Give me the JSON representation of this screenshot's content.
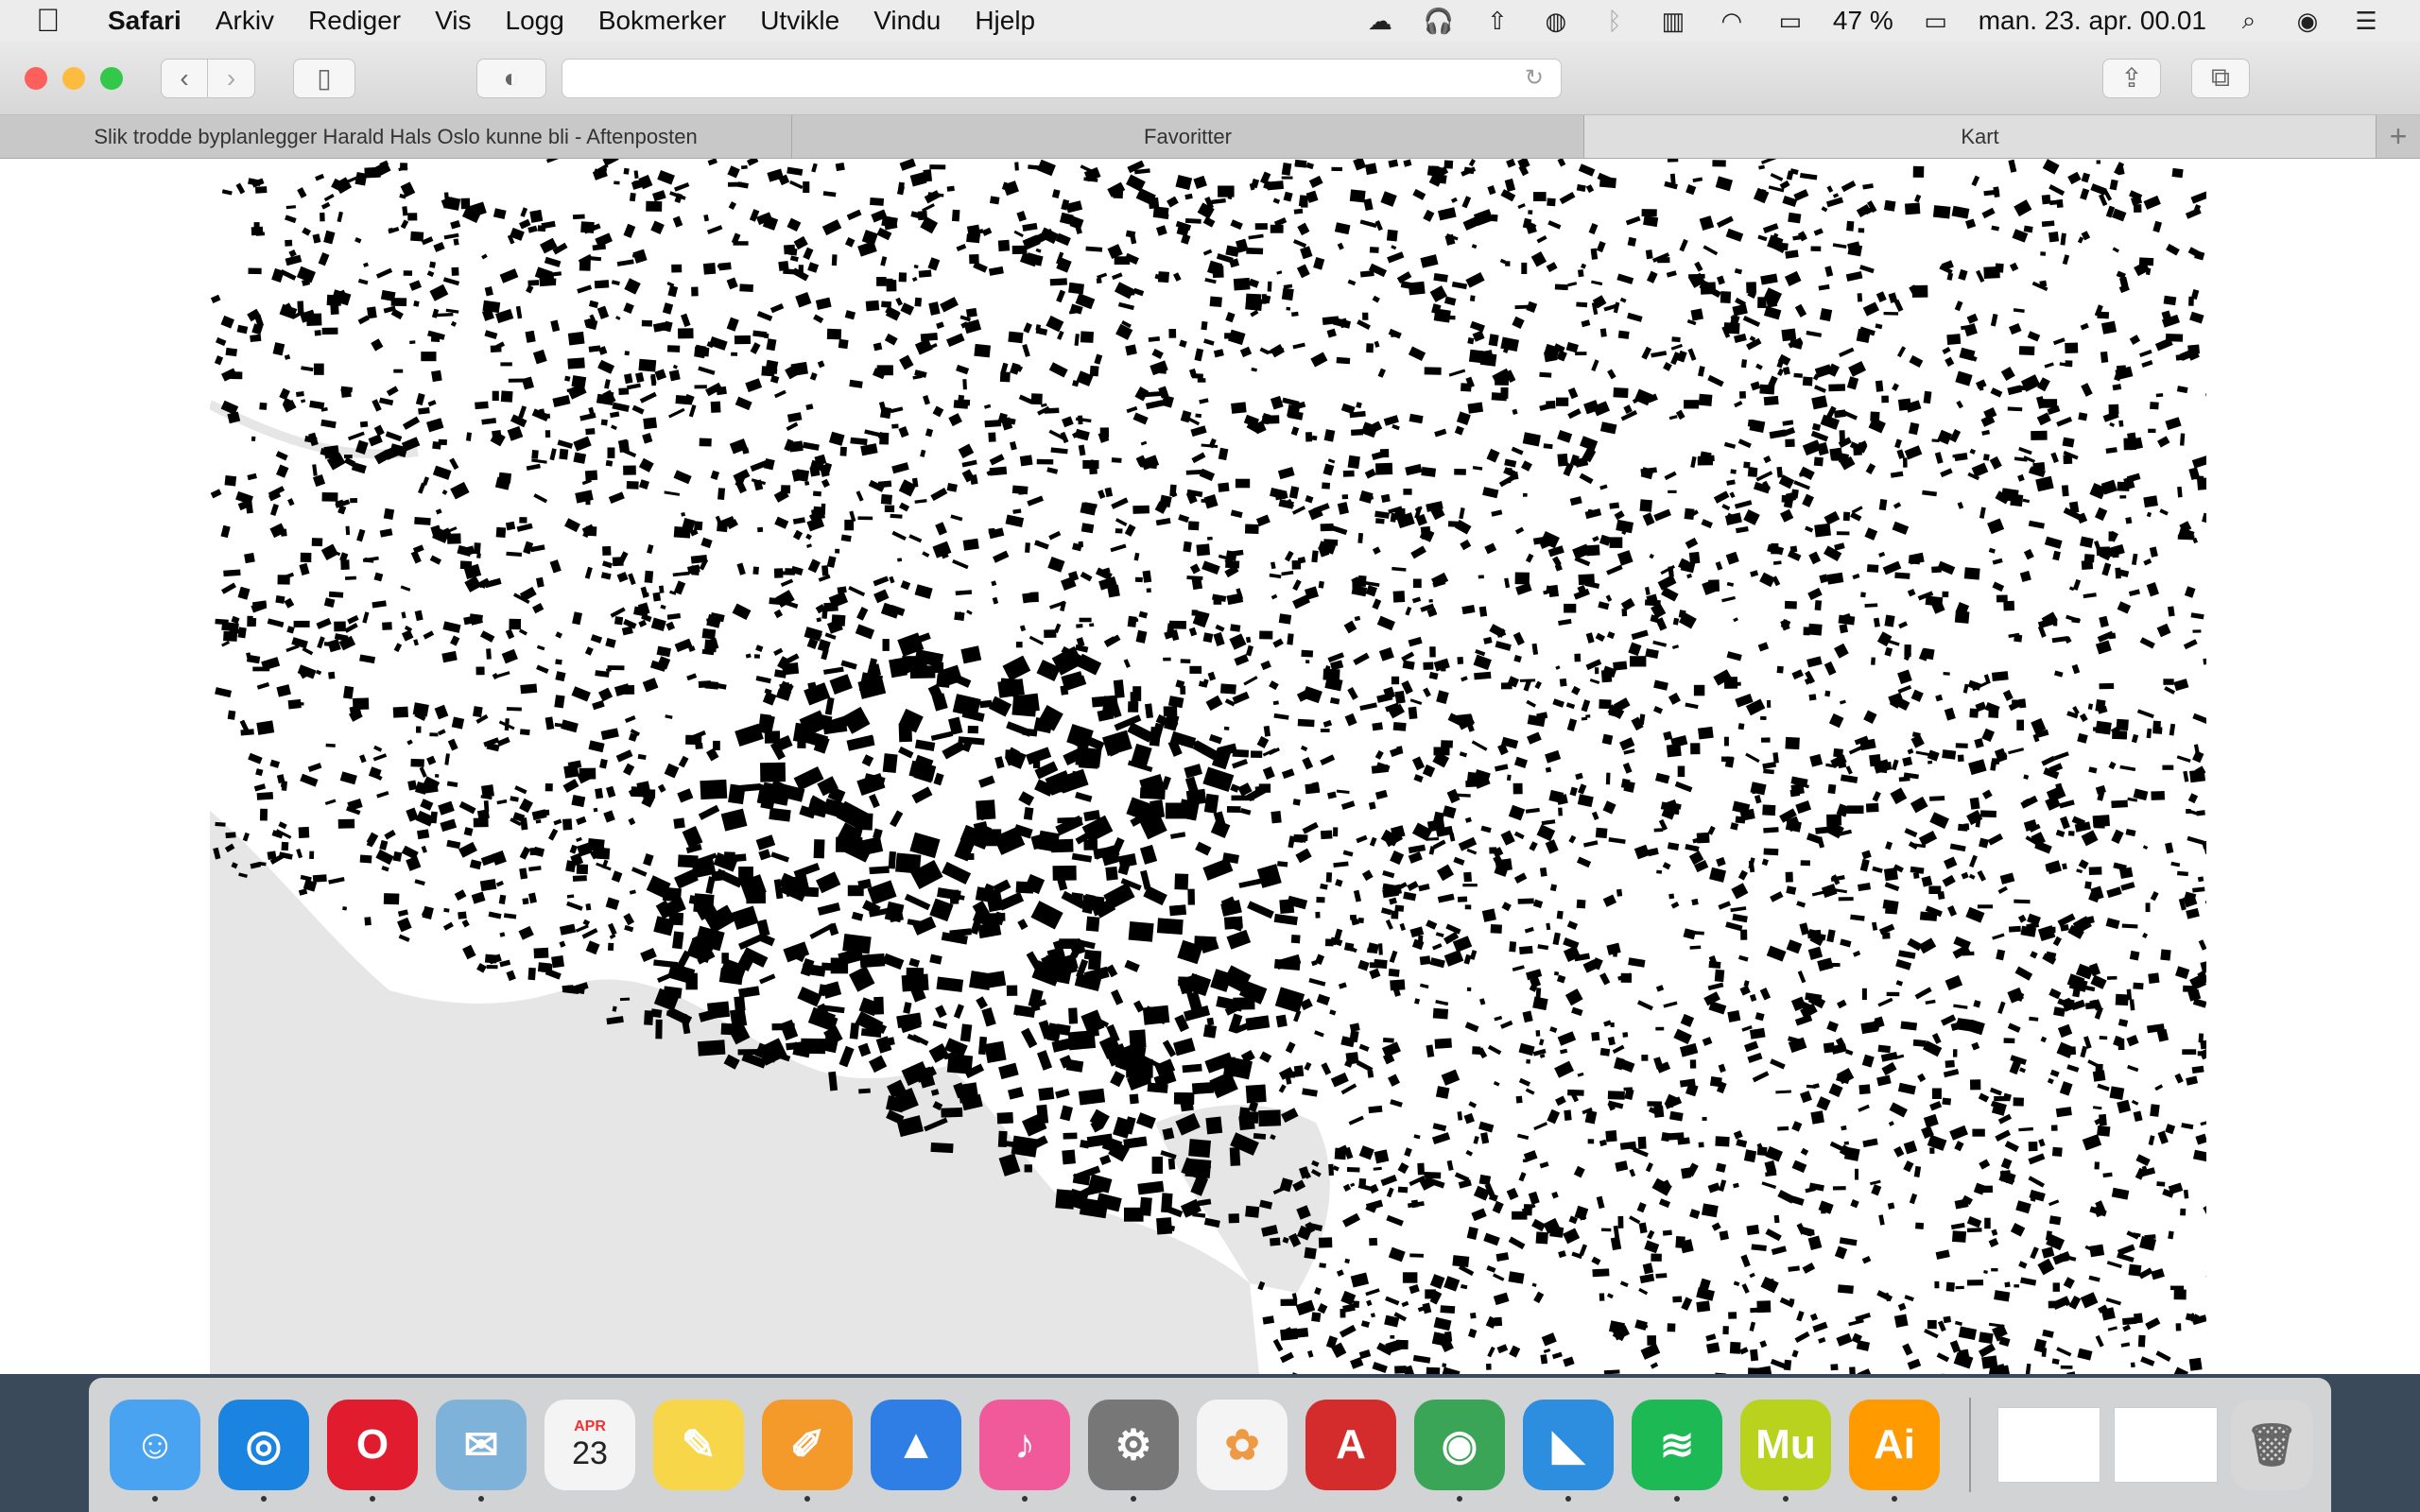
{
  "menubar": {
    "app_name": "Safari",
    "items": [
      "Arkiv",
      "Rediger",
      "Vis",
      "Logg",
      "Bokmerker",
      "Utvikle",
      "Vindu",
      "Hjelp"
    ],
    "battery": "47 %",
    "clock": "man. 23. apr. 00.01"
  },
  "tabs": [
    {
      "label": "Slik trodde byplanlegger Harald Hals Oslo kunne bli - Aftenposten"
    },
    {
      "label": "Favoritter"
    },
    {
      "label": "Kart"
    }
  ],
  "url_field": {
    "value": ""
  },
  "colors": {
    "close": "#fc605c",
    "minimize": "#fdbc40",
    "zoom": "#34c84a",
    "water": "#e6e6e6",
    "buildings": "#000000"
  },
  "dock": {
    "apps": [
      {
        "name": "finder-icon",
        "glyph": "☺",
        "color": "#4aa3f0",
        "running": true
      },
      {
        "name": "safari-icon",
        "glyph": "◎",
        "color": "#1a84e0",
        "running": true
      },
      {
        "name": "opera-icon",
        "glyph": "O",
        "color": "#e01c2e",
        "running": true
      },
      {
        "name": "mail-icon",
        "glyph": "✉",
        "color": "#7fb2d8",
        "running": true
      },
      {
        "name": "calendar-icon",
        "glyph": "23",
        "color": "#f4f4f4",
        "running": false
      },
      {
        "name": "notes-icon",
        "glyph": "✎",
        "color": "#f7d64a",
        "running": false
      },
      {
        "name": "pages-icon",
        "glyph": "✐",
        "color": "#f39a2b",
        "running": true
      },
      {
        "name": "keynote-icon",
        "glyph": "▲",
        "color": "#2f7ee5",
        "running": false
      },
      {
        "name": "itunes-icon",
        "glyph": "♪",
        "color": "#f05a9a",
        "running": true
      },
      {
        "name": "system-preferences-icon",
        "glyph": "⚙",
        "color": "#777777",
        "running": true
      },
      {
        "name": "photos-icon",
        "glyph": "✿",
        "color": "#f4f4f4",
        "running": false
      },
      {
        "name": "autocad-icon",
        "glyph": "A",
        "color": "#d42c2c",
        "running": false
      },
      {
        "name": "chrome-icon",
        "glyph": "◉",
        "color": "#3aa556",
        "running": true
      },
      {
        "name": "archicad-icon",
        "glyph": "◣",
        "color": "#2d8ee0",
        "running": true
      },
      {
        "name": "spotify-icon",
        "glyph": "≋",
        "color": "#1db954",
        "running": true
      },
      {
        "name": "muse-icon",
        "glyph": "Mu",
        "color": "#b9d21e",
        "running": true
      },
      {
        "name": "illustrator-icon",
        "glyph": "Ai",
        "color": "#ff9a00",
        "running": true
      }
    ],
    "calendar_month": "APR",
    "calendar_day": "23"
  }
}
